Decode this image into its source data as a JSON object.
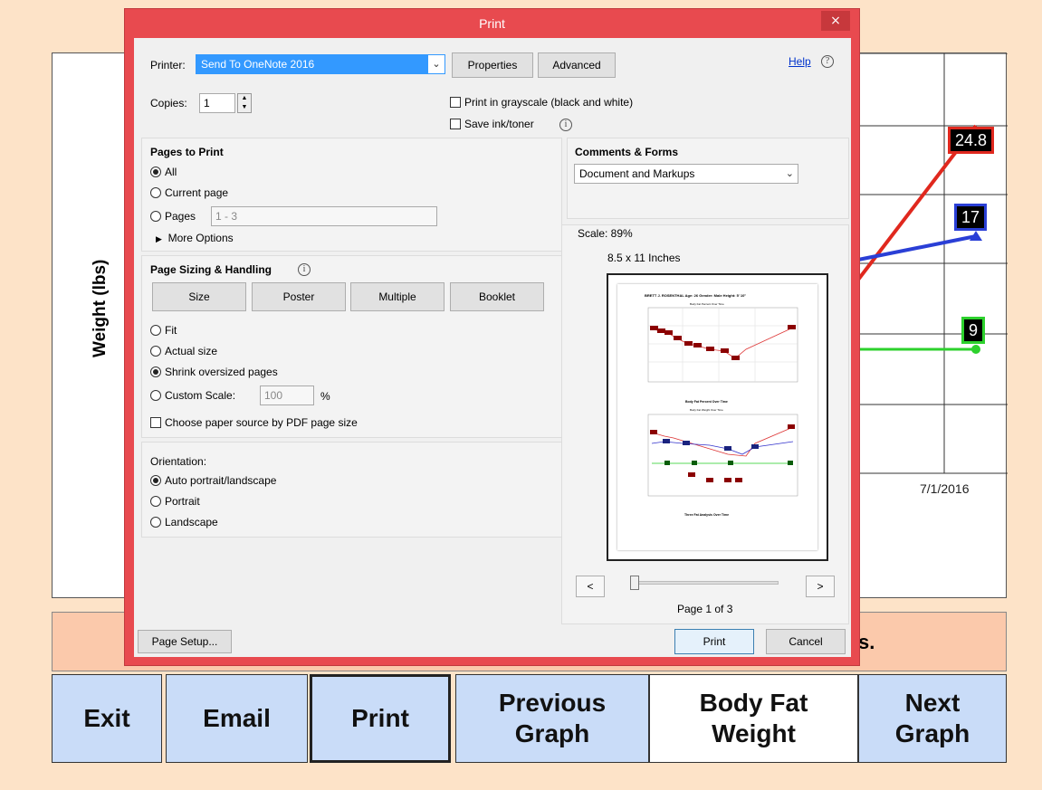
{
  "background": {
    "y_axis_label": "Weight (lbs)",
    "date_label": "7/1/2016",
    "tags": {
      "red": "24.8",
      "blue": "17",
      "green": "9"
    },
    "message_tail": "s.",
    "colors": {
      "red": "#e0281e",
      "blue": "#2a3fd6",
      "green": "#2dd12d"
    }
  },
  "nav": {
    "exit": "Exit",
    "email": "Email",
    "print": "Print",
    "previous_graph": "Previous\nGraph",
    "body_fat_weight": "Body Fat\nWeight",
    "next_graph": "Next\nGraph"
  },
  "dialog": {
    "title": "Print",
    "close": "×",
    "printer_label": "Printer:",
    "printer_value": "Send To OneNote 2016",
    "properties": "Properties",
    "advanced": "Advanced",
    "help": "Help",
    "copies_label": "Copies:",
    "copies_value": "1",
    "grayscale": "Print in grayscale (black and white)",
    "save_ink": "Save ink/toner",
    "pages_to_print": "Pages to Print",
    "all": "All",
    "current_page": "Current page",
    "pages": "Pages",
    "pages_value": "1 - 3",
    "more_options": "More Options",
    "page_sizing": "Page Sizing & Handling",
    "size": "Size",
    "poster": "Poster",
    "multiple": "Multiple",
    "booklet": "Booklet",
    "fit": "Fit",
    "actual_size": "Actual size",
    "shrink": "Shrink oversized pages",
    "custom_scale": "Custom Scale:",
    "custom_scale_value": "100",
    "percent": "%",
    "paper_source": "Choose paper source by PDF page size",
    "orientation": "Orientation:",
    "auto_portrait": "Auto portrait/landscape",
    "portrait": "Portrait",
    "landscape": "Landscape",
    "comments_forms": "Comments & Forms",
    "comments_value": "Document and Markups",
    "scale": "Scale:  89%",
    "paper_size": "8.5 x 11 Inches",
    "prev_page": "<",
    "next_page": ">",
    "page_indicator": "Page 1 of 3",
    "page_setup": "Page Setup...",
    "print": "Print",
    "cancel": "Cancel"
  },
  "preview": {
    "header": "BRETT J. ROSENTHAL Age: 26 Gender: Male Height: 5' 10\"",
    "chart1_title": "Body Fat Percent Over Time",
    "chart1_caption": "Body Fat Percent Over Time",
    "chart2_title": "Body Fat Weight Over Time",
    "chart2_caption": "Three Fat Analysis Over Time"
  }
}
